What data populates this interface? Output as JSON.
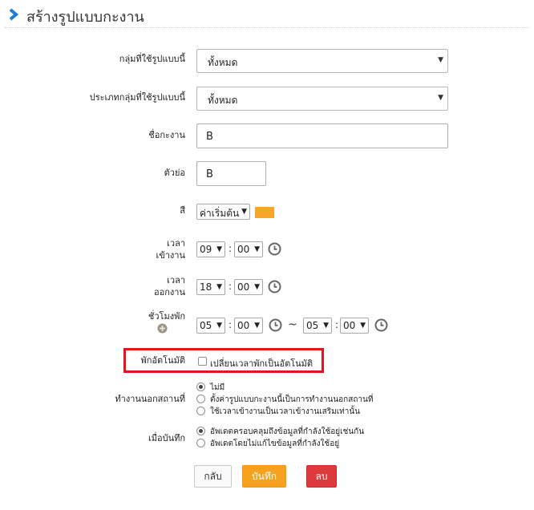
{
  "header": {
    "title": "สร้างรูปแบบกะงาน",
    "accent": "#1f7bd6"
  },
  "form": {
    "group_label": "กลุ่มที่ใช้รูปแบบนี้",
    "group_value": "ทั้งหมด",
    "group_type_label": "ประเภทกลุ่มที่ใช้รูปแบบนี้",
    "group_type_value": "ทั้งหมด",
    "shift_name_label": "ชื่อกะงาน",
    "shift_name_value": "B",
    "abbr_label": "ตัวย่อ",
    "abbr_value": "B",
    "color_label": "สี",
    "color_value": "ค่าเริ่มต้น",
    "color_swatch": "#f7a627",
    "start_label_1": "เวลา",
    "start_label_2": "เข้างาน",
    "start_hour": "09",
    "start_min": "00",
    "end_label_1": "เวลา",
    "end_label_2": "ออกงาน",
    "end_hour": "18",
    "end_min": "00",
    "break_label": "ชั่วโมงพัก",
    "break_from_hour": "05",
    "break_from_min": "00",
    "tilde": "~",
    "break_to_hour": "05",
    "break_to_min": "00",
    "auto_break_label": "พักอัตโนมัติ",
    "auto_break_option": "เปลี่ยนเวลาพักเป็นอัตโนมัติ",
    "offsite_label": "ทำงานนอกสถานที่",
    "offsite_options": [
      "ไม่มี",
      "ตั้งค่ารูปแบบกะงานนี้เป็นการทำงานนอกสถานที่",
      "ใช้เวลาเข้างานเป็นเวลาเข้างานเสริมเท่านั้น"
    ],
    "on_save_label": "เมื่อบันทึก",
    "on_save_options": [
      "อัพเดตครอบคลุมถึงข้อมูลที่กำลังใช้อยู่เช่นกัน",
      "อัพเดตโดยไม่แก้ไขข้อมูลที่กำลังใช้อยู่"
    ],
    "colon": ":"
  },
  "buttons": {
    "back": "กลับ",
    "save": "บันทึก",
    "delete": "ลบ"
  },
  "colors": {
    "save_button": "#f7a21f",
    "delete_button": "#dd3a3e",
    "highlight_box": "#e3141d"
  }
}
